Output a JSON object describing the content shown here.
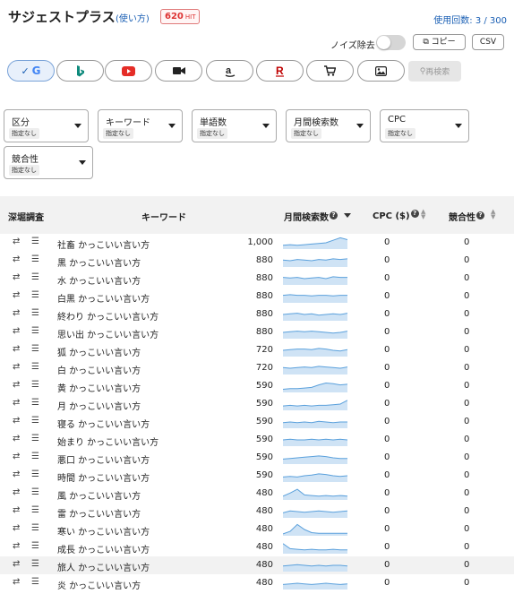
{
  "header": {
    "title": "サジェストプラス",
    "help_link": "(使い方)",
    "hit_count": "620",
    "hit_unit": "HIT",
    "usage": "使用回数: 3 / 300"
  },
  "toolbar": {
    "noise_label": "ノイズ除去",
    "noise_enabled": false,
    "copy_label": "コピー",
    "csv_label": "CSV",
    "search_label": "再検索"
  },
  "engines": [
    {
      "name": "google",
      "icon": "google-icon",
      "active": true
    },
    {
      "name": "bing",
      "icon": "bing-icon",
      "active": false
    },
    {
      "name": "youtube",
      "icon": "youtube-icon",
      "active": false
    },
    {
      "name": "video",
      "icon": "video-camera-icon",
      "active": false
    },
    {
      "name": "amazon",
      "icon": "amazon-icon",
      "active": false
    },
    {
      "name": "rakuten",
      "icon": "rakuten-icon",
      "active": false
    },
    {
      "name": "shopping",
      "icon": "cart-icon",
      "active": false
    },
    {
      "name": "images",
      "icon": "image-icon",
      "active": false
    }
  ],
  "filters": [
    {
      "label": "区分",
      "value": "指定なし"
    },
    {
      "label": "キーワード",
      "value": "指定なし"
    },
    {
      "label": "単語数",
      "value": "指定なし"
    },
    {
      "label": "月間検索数",
      "value": "指定なし"
    },
    {
      "label": "CPC",
      "value": "指定なし"
    },
    {
      "label": "競合性",
      "value": "指定なし"
    }
  ],
  "table": {
    "columns": {
      "dig": "深堀調査",
      "keyword": "キーワード",
      "volume": "月間検索数",
      "cpc": "CPC ($)",
      "competition": "競合性"
    },
    "rows": [
      {
        "keyword": "社畜 かっこいい言い方",
        "volume": "1,000",
        "cpc": "0",
        "competition": "0",
        "trend": [
          0.3,
          0.35,
          0.3,
          0.35,
          0.4,
          0.45,
          0.5,
          0.7,
          0.9,
          0.75
        ]
      },
      {
        "keyword": "黒 かっこいい言い方",
        "volume": "880",
        "cpc": "0",
        "competition": "0",
        "trend": [
          0.55,
          0.5,
          0.6,
          0.55,
          0.5,
          0.6,
          0.55,
          0.65,
          0.6,
          0.65
        ]
      },
      {
        "keyword": "水 かっこいい言い方",
        "volume": "880",
        "cpc": "0",
        "competition": "0",
        "trend": [
          0.6,
          0.55,
          0.6,
          0.5,
          0.55,
          0.6,
          0.5,
          0.65,
          0.6,
          0.6
        ]
      },
      {
        "keyword": "白黒 かっこいい言い方",
        "volume": "880",
        "cpc": "0",
        "competition": "0",
        "trend": [
          0.6,
          0.65,
          0.6,
          0.6,
          0.55,
          0.6,
          0.6,
          0.55,
          0.6,
          0.6
        ]
      },
      {
        "keyword": "終わり かっこいい言い方",
        "volume": "880",
        "cpc": "0",
        "competition": "0",
        "trend": [
          0.5,
          0.55,
          0.6,
          0.5,
          0.55,
          0.45,
          0.5,
          0.55,
          0.5,
          0.6
        ]
      },
      {
        "keyword": "思い出 かっこいい言い方",
        "volume": "880",
        "cpc": "0",
        "competition": "0",
        "trend": [
          0.5,
          0.55,
          0.6,
          0.55,
          0.6,
          0.55,
          0.5,
          0.45,
          0.5,
          0.6
        ]
      },
      {
        "keyword": "狐 かっこいい言い方",
        "volume": "720",
        "cpc": "0",
        "competition": "0",
        "trend": [
          0.5,
          0.55,
          0.6,
          0.6,
          0.55,
          0.65,
          0.6,
          0.5,
          0.45,
          0.55
        ]
      },
      {
        "keyword": "白 かっこいい言い方",
        "volume": "720",
        "cpc": "0",
        "competition": "0",
        "trend": [
          0.55,
          0.5,
          0.55,
          0.6,
          0.55,
          0.65,
          0.6,
          0.55,
          0.5,
          0.6
        ]
      },
      {
        "keyword": "黄 かっこいい言い方",
        "volume": "590",
        "cpc": "0",
        "competition": "0",
        "trend": [
          0.25,
          0.3,
          0.3,
          0.35,
          0.4,
          0.6,
          0.75,
          0.7,
          0.6,
          0.65
        ]
      },
      {
        "keyword": "月 かっこいい言い方",
        "volume": "590",
        "cpc": "0",
        "competition": "0",
        "trend": [
          0.35,
          0.4,
          0.35,
          0.4,
          0.35,
          0.4,
          0.4,
          0.45,
          0.5,
          0.8
        ]
      },
      {
        "keyword": "寝る かっこいい言い方",
        "volume": "590",
        "cpc": "0",
        "competition": "0",
        "trend": [
          0.45,
          0.5,
          0.45,
          0.5,
          0.45,
          0.55,
          0.5,
          0.45,
          0.5,
          0.5
        ]
      },
      {
        "keyword": "始まり かっこいい言い方",
        "volume": "590",
        "cpc": "0",
        "competition": "0",
        "trend": [
          0.5,
          0.55,
          0.5,
          0.5,
          0.55,
          0.5,
          0.55,
          0.5,
          0.55,
          0.5
        ]
      },
      {
        "keyword": "悪口 かっこいい言い方",
        "volume": "590",
        "cpc": "0",
        "competition": "0",
        "trend": [
          0.4,
          0.45,
          0.5,
          0.55,
          0.6,
          0.65,
          0.6,
          0.5,
          0.45,
          0.45
        ]
      },
      {
        "keyword": "時間 かっこいい言い方",
        "volume": "590",
        "cpc": "0",
        "competition": "0",
        "trend": [
          0.4,
          0.45,
          0.4,
          0.5,
          0.55,
          0.65,
          0.6,
          0.5,
          0.45,
          0.5
        ]
      },
      {
        "keyword": "風 かっこいい言い方",
        "volume": "480",
        "cpc": "0",
        "competition": "0",
        "trend": [
          0.3,
          0.55,
          0.85,
          0.4,
          0.35,
          0.3,
          0.35,
          0.3,
          0.35,
          0.3
        ]
      },
      {
        "keyword": "雷 かっこいい言い方",
        "volume": "480",
        "cpc": "0",
        "competition": "0",
        "trend": [
          0.4,
          0.55,
          0.5,
          0.45,
          0.5,
          0.55,
          0.5,
          0.45,
          0.5,
          0.55
        ]
      },
      {
        "keyword": "寒い かっこいい言い方",
        "volume": "480",
        "cpc": "0",
        "competition": "0",
        "trend": [
          0.15,
          0.35,
          0.9,
          0.5,
          0.25,
          0.2,
          0.2,
          0.2,
          0.2,
          0.2
        ]
      },
      {
        "keyword": "成長 かっこいい言い方",
        "volume": "480",
        "cpc": "0",
        "competition": "0",
        "trend": [
          0.8,
          0.4,
          0.35,
          0.3,
          0.35,
          0.3,
          0.3,
          0.35,
          0.3,
          0.3
        ]
      },
      {
        "keyword": "旅人 かっこいい言い方",
        "volume": "480",
        "cpc": "0",
        "competition": "0",
        "trend": [
          0.45,
          0.5,
          0.55,
          0.5,
          0.45,
          0.5,
          0.45,
          0.5,
          0.5,
          0.45
        ]
      },
      {
        "keyword": "炎 かっこいい言い方",
        "volume": "480",
        "cpc": "0",
        "competition": "0",
        "trend": [
          0.4,
          0.45,
          0.5,
          0.45,
          0.4,
          0.45,
          0.5,
          0.45,
          0.4,
          0.45
        ]
      }
    ]
  },
  "colors": {
    "accent": "#1a5fb4",
    "spark_line": "#5aa0dc",
    "spark_fill": "#cfe3f5",
    "row_highlight": "#f2f2f2"
  }
}
